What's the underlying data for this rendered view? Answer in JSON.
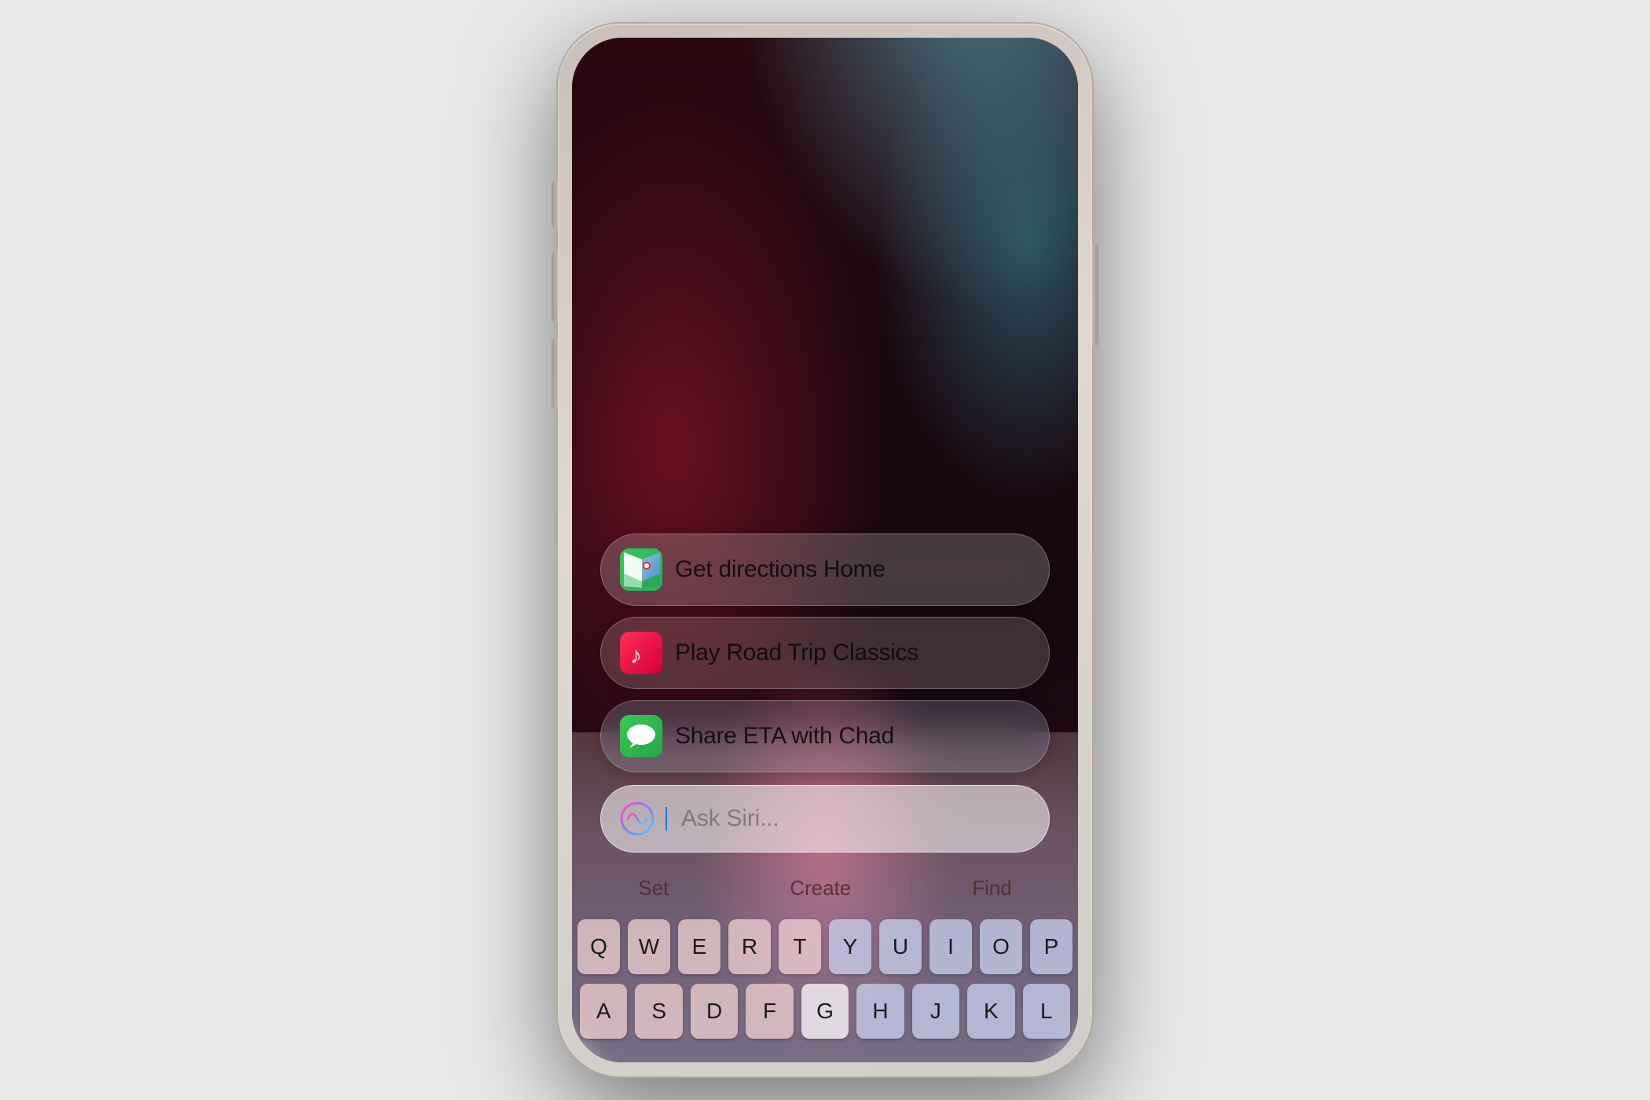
{
  "phone": {
    "suggestions": [
      {
        "id": "directions",
        "app": "Maps",
        "icon_type": "maps",
        "text": "Get directions Home"
      },
      {
        "id": "music",
        "app": "Music",
        "icon_type": "music",
        "text": "Play Road Trip Classics"
      },
      {
        "id": "messages",
        "app": "Messages",
        "icon_type": "messages",
        "text": "Share ETA with Chad"
      }
    ],
    "siri_bar": {
      "placeholder": "Ask Siri..."
    },
    "quick_actions": {
      "items": [
        "Set",
        "Create",
        "Find"
      ]
    },
    "keyboard": {
      "rows": [
        [
          "Q",
          "W",
          "E",
          "R",
          "T",
          "Y",
          "U",
          "I",
          "O",
          "P"
        ],
        [
          "A",
          "S",
          "D",
          "F",
          "G",
          "H",
          "J",
          "K",
          "L"
        ]
      ]
    }
  }
}
